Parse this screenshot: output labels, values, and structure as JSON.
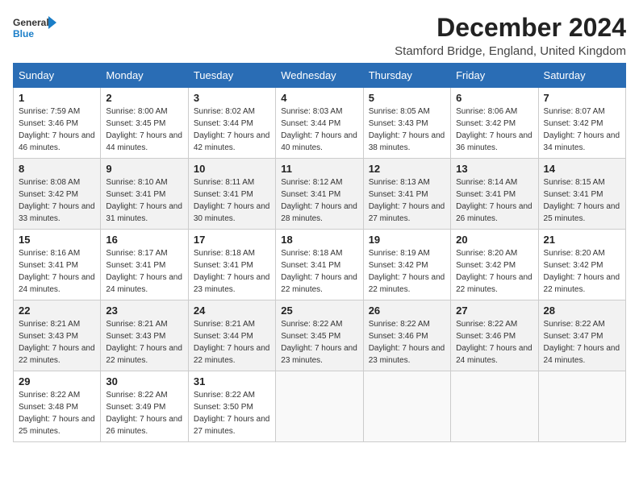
{
  "logo": {
    "line1": "General",
    "line2": "Blue"
  },
  "title": "December 2024",
  "location": "Stamford Bridge, England, United Kingdom",
  "days_of_week": [
    "Sunday",
    "Monday",
    "Tuesday",
    "Wednesday",
    "Thursday",
    "Friday",
    "Saturday"
  ],
  "weeks": [
    [
      {
        "day": "1",
        "sunrise": "Sunrise: 7:59 AM",
        "sunset": "Sunset: 3:46 PM",
        "daylight": "Daylight: 7 hours and 46 minutes."
      },
      {
        "day": "2",
        "sunrise": "Sunrise: 8:00 AM",
        "sunset": "Sunset: 3:45 PM",
        "daylight": "Daylight: 7 hours and 44 minutes."
      },
      {
        "day": "3",
        "sunrise": "Sunrise: 8:02 AM",
        "sunset": "Sunset: 3:44 PM",
        "daylight": "Daylight: 7 hours and 42 minutes."
      },
      {
        "day": "4",
        "sunrise": "Sunrise: 8:03 AM",
        "sunset": "Sunset: 3:44 PM",
        "daylight": "Daylight: 7 hours and 40 minutes."
      },
      {
        "day": "5",
        "sunrise": "Sunrise: 8:05 AM",
        "sunset": "Sunset: 3:43 PM",
        "daylight": "Daylight: 7 hours and 38 minutes."
      },
      {
        "day": "6",
        "sunrise": "Sunrise: 8:06 AM",
        "sunset": "Sunset: 3:42 PM",
        "daylight": "Daylight: 7 hours and 36 minutes."
      },
      {
        "day": "7",
        "sunrise": "Sunrise: 8:07 AM",
        "sunset": "Sunset: 3:42 PM",
        "daylight": "Daylight: 7 hours and 34 minutes."
      }
    ],
    [
      {
        "day": "8",
        "sunrise": "Sunrise: 8:08 AM",
        "sunset": "Sunset: 3:42 PM",
        "daylight": "Daylight: 7 hours and 33 minutes."
      },
      {
        "day": "9",
        "sunrise": "Sunrise: 8:10 AM",
        "sunset": "Sunset: 3:41 PM",
        "daylight": "Daylight: 7 hours and 31 minutes."
      },
      {
        "day": "10",
        "sunrise": "Sunrise: 8:11 AM",
        "sunset": "Sunset: 3:41 PM",
        "daylight": "Daylight: 7 hours and 30 minutes."
      },
      {
        "day": "11",
        "sunrise": "Sunrise: 8:12 AM",
        "sunset": "Sunset: 3:41 PM",
        "daylight": "Daylight: 7 hours and 28 minutes."
      },
      {
        "day": "12",
        "sunrise": "Sunrise: 8:13 AM",
        "sunset": "Sunset: 3:41 PM",
        "daylight": "Daylight: 7 hours and 27 minutes."
      },
      {
        "day": "13",
        "sunrise": "Sunrise: 8:14 AM",
        "sunset": "Sunset: 3:41 PM",
        "daylight": "Daylight: 7 hours and 26 minutes."
      },
      {
        "day": "14",
        "sunrise": "Sunrise: 8:15 AM",
        "sunset": "Sunset: 3:41 PM",
        "daylight": "Daylight: 7 hours and 25 minutes."
      }
    ],
    [
      {
        "day": "15",
        "sunrise": "Sunrise: 8:16 AM",
        "sunset": "Sunset: 3:41 PM",
        "daylight": "Daylight: 7 hours and 24 minutes."
      },
      {
        "day": "16",
        "sunrise": "Sunrise: 8:17 AM",
        "sunset": "Sunset: 3:41 PM",
        "daylight": "Daylight: 7 hours and 24 minutes."
      },
      {
        "day": "17",
        "sunrise": "Sunrise: 8:18 AM",
        "sunset": "Sunset: 3:41 PM",
        "daylight": "Daylight: 7 hours and 23 minutes."
      },
      {
        "day": "18",
        "sunrise": "Sunrise: 8:18 AM",
        "sunset": "Sunset: 3:41 PM",
        "daylight": "Daylight: 7 hours and 22 minutes."
      },
      {
        "day": "19",
        "sunrise": "Sunrise: 8:19 AM",
        "sunset": "Sunset: 3:42 PM",
        "daylight": "Daylight: 7 hours and 22 minutes."
      },
      {
        "day": "20",
        "sunrise": "Sunrise: 8:20 AM",
        "sunset": "Sunset: 3:42 PM",
        "daylight": "Daylight: 7 hours and 22 minutes."
      },
      {
        "day": "21",
        "sunrise": "Sunrise: 8:20 AM",
        "sunset": "Sunset: 3:42 PM",
        "daylight": "Daylight: 7 hours and 22 minutes."
      }
    ],
    [
      {
        "day": "22",
        "sunrise": "Sunrise: 8:21 AM",
        "sunset": "Sunset: 3:43 PM",
        "daylight": "Daylight: 7 hours and 22 minutes."
      },
      {
        "day": "23",
        "sunrise": "Sunrise: 8:21 AM",
        "sunset": "Sunset: 3:43 PM",
        "daylight": "Daylight: 7 hours and 22 minutes."
      },
      {
        "day": "24",
        "sunrise": "Sunrise: 8:21 AM",
        "sunset": "Sunset: 3:44 PM",
        "daylight": "Daylight: 7 hours and 22 minutes."
      },
      {
        "day": "25",
        "sunrise": "Sunrise: 8:22 AM",
        "sunset": "Sunset: 3:45 PM",
        "daylight": "Daylight: 7 hours and 23 minutes."
      },
      {
        "day": "26",
        "sunrise": "Sunrise: 8:22 AM",
        "sunset": "Sunset: 3:46 PM",
        "daylight": "Daylight: 7 hours and 23 minutes."
      },
      {
        "day": "27",
        "sunrise": "Sunrise: 8:22 AM",
        "sunset": "Sunset: 3:46 PM",
        "daylight": "Daylight: 7 hours and 24 minutes."
      },
      {
        "day": "28",
        "sunrise": "Sunrise: 8:22 AM",
        "sunset": "Sunset: 3:47 PM",
        "daylight": "Daylight: 7 hours and 24 minutes."
      }
    ],
    [
      {
        "day": "29",
        "sunrise": "Sunrise: 8:22 AM",
        "sunset": "Sunset: 3:48 PM",
        "daylight": "Daylight: 7 hours and 25 minutes."
      },
      {
        "day": "30",
        "sunrise": "Sunrise: 8:22 AM",
        "sunset": "Sunset: 3:49 PM",
        "daylight": "Daylight: 7 hours and 26 minutes."
      },
      {
        "day": "31",
        "sunrise": "Sunrise: 8:22 AM",
        "sunset": "Sunset: 3:50 PM",
        "daylight": "Daylight: 7 hours and 27 minutes."
      },
      null,
      null,
      null,
      null
    ]
  ]
}
